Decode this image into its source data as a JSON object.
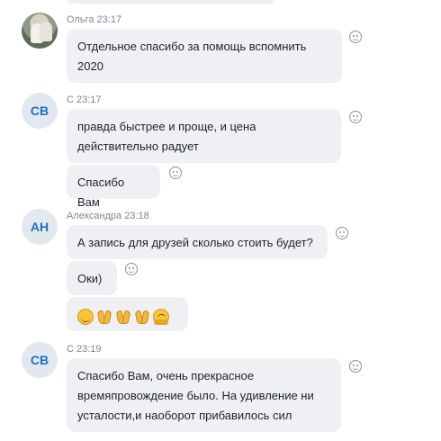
{
  "messages": [
    {
      "sender": "Ольга",
      "time": "23:17",
      "avatar_initials": "",
      "bubbles": [
        {
          "lines": [
            "Отдельное спасибо за помощь вспомнить",
            "2020"
          ]
        }
      ]
    },
    {
      "sender": "С",
      "time": "23:17",
      "avatar_initials": "СВ",
      "bubbles": [
        {
          "lines": [
            "правда быстрее и проще, и цена",
            "действительно радует"
          ]
        },
        {
          "lines": [
            "Спасибо Вам"
          ]
        }
      ]
    },
    {
      "sender": "Александра",
      "time": "23:18",
      "avatar_initials": "АН",
      "bubbles": [
        {
          "lines": [
            "А запись для друзей сколько стоить будет?"
          ]
        },
        {
          "lines": [
            "Оки)"
          ]
        },
        {
          "emoji": [
            "grinning-face",
            "folded-hands",
            "folded-hands",
            "folded-hands",
            "hugging-face"
          ]
        }
      ]
    },
    {
      "sender": "С",
      "time": "23:19",
      "avatar_initials": "СВ",
      "bubbles": [
        {
          "lines": [
            "Спасибо Вам, очень прекрасное",
            "времяпровождение было. На удивление ни",
            "усталости,и наоборот прибавилось сил"
          ]
        }
      ]
    }
  ],
  "icons": {
    "reaction": "add-reaction-smiley-icon"
  },
  "colors": {
    "bubble_bg": "#eef0f4",
    "initials": "#1a6fc4",
    "meta_text": "#7b8594"
  }
}
